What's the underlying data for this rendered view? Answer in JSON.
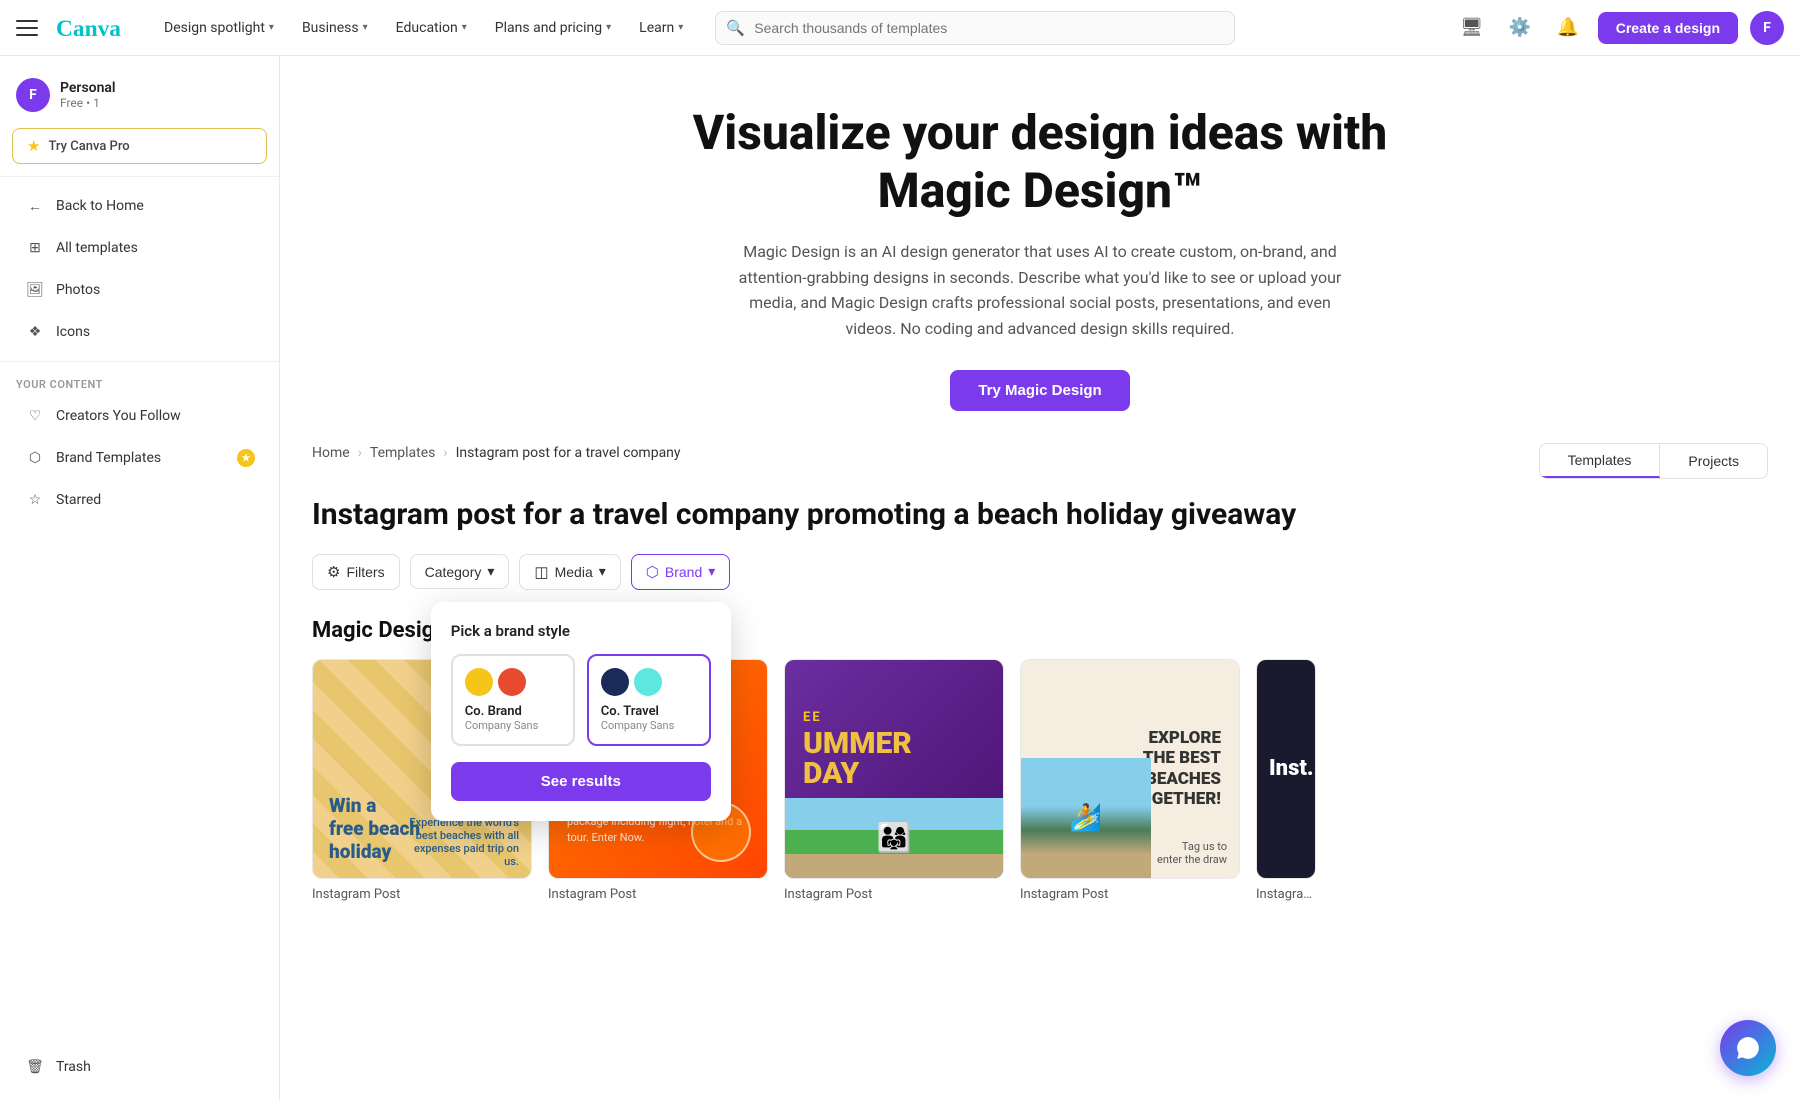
{
  "app": {
    "name": "Canva",
    "avatar_letter": "F"
  },
  "nav": {
    "links": [
      {
        "label": "Design spotlight",
        "id": "design-spotlight"
      },
      {
        "label": "Business",
        "id": "business"
      },
      {
        "label": "Education",
        "id": "education"
      },
      {
        "label": "Plans and pricing",
        "id": "plans"
      },
      {
        "label": "Learn",
        "id": "learn"
      }
    ],
    "search_placeholder": "Search thousands of templates",
    "create_btn": "Create a design"
  },
  "sidebar": {
    "user_name": "Personal",
    "user_plan": "Free • 1",
    "try_pro": "Try Canva Pro",
    "items": [
      {
        "label": "Back to Home",
        "icon": "arrow-left",
        "id": "back-home"
      },
      {
        "label": "All templates",
        "icon": "grid",
        "id": "all-templates"
      },
      {
        "label": "Photos",
        "icon": "photo",
        "id": "photos"
      },
      {
        "label": "Icons",
        "icon": "icons",
        "id": "icons"
      }
    ],
    "your_content_label": "Your Content",
    "content_items": [
      {
        "label": "Creators You Follow",
        "icon": "heart",
        "id": "creators"
      },
      {
        "label": "Brand Templates",
        "icon": "brand",
        "id": "brand-templates",
        "badge": true
      },
      {
        "label": "Starred",
        "icon": "star",
        "id": "starred"
      }
    ],
    "trash_label": "Trash"
  },
  "hero": {
    "title_line1": "Visualize your design ideas with",
    "title_line2": "Magic Design™",
    "description": "Magic Design is an AI design generator that uses AI to create custom, on-brand, and attention-grabbing designs in seconds. Describe what you'd like to see or upload your media, and Magic Design crafts professional social posts, presentations, and even videos. No coding and advanced design skills required.",
    "cta_btn": "Try Magic Design"
  },
  "breadcrumb": {
    "home": "Home",
    "templates": "Templates",
    "current": "Instagram post for a travel company"
  },
  "tabs": [
    {
      "label": "Templates",
      "active": true
    },
    {
      "label": "Projects",
      "active": false
    }
  ],
  "page_title": "Instagram post for a travel company promoting a beach holiday giveaway",
  "filters": {
    "filters_btn": "Filters",
    "category_btn": "Category",
    "media_btn": "Media",
    "brand_btn": "Brand"
  },
  "brand_dropdown": {
    "title": "Pick a brand style",
    "options": [
      {
        "name": "Co. Brand",
        "font": "Company Sans",
        "swatches": [
          "#f5c518",
          "#e84a2f"
        ],
        "selected": false
      },
      {
        "name": "Co. Travel",
        "font": "Company Sans",
        "swatches": [
          "#1a2a5a",
          "#5ce8e0"
        ],
        "selected": true
      }
    ],
    "see_results_btn": "See results"
  },
  "magic_design": {
    "section_title": "Magic Design",
    "templates": [
      {
        "label": "Instagram Post",
        "type": "beach-stripes"
      },
      {
        "label": "Instagram Post",
        "type": "orange-promo"
      },
      {
        "label": "Instagram Post",
        "type": "dark-summer"
      },
      {
        "label": "Instagram Post",
        "type": "tan-explore"
      },
      {
        "label": "Instagram Post",
        "type": "dark-navy"
      }
    ]
  }
}
